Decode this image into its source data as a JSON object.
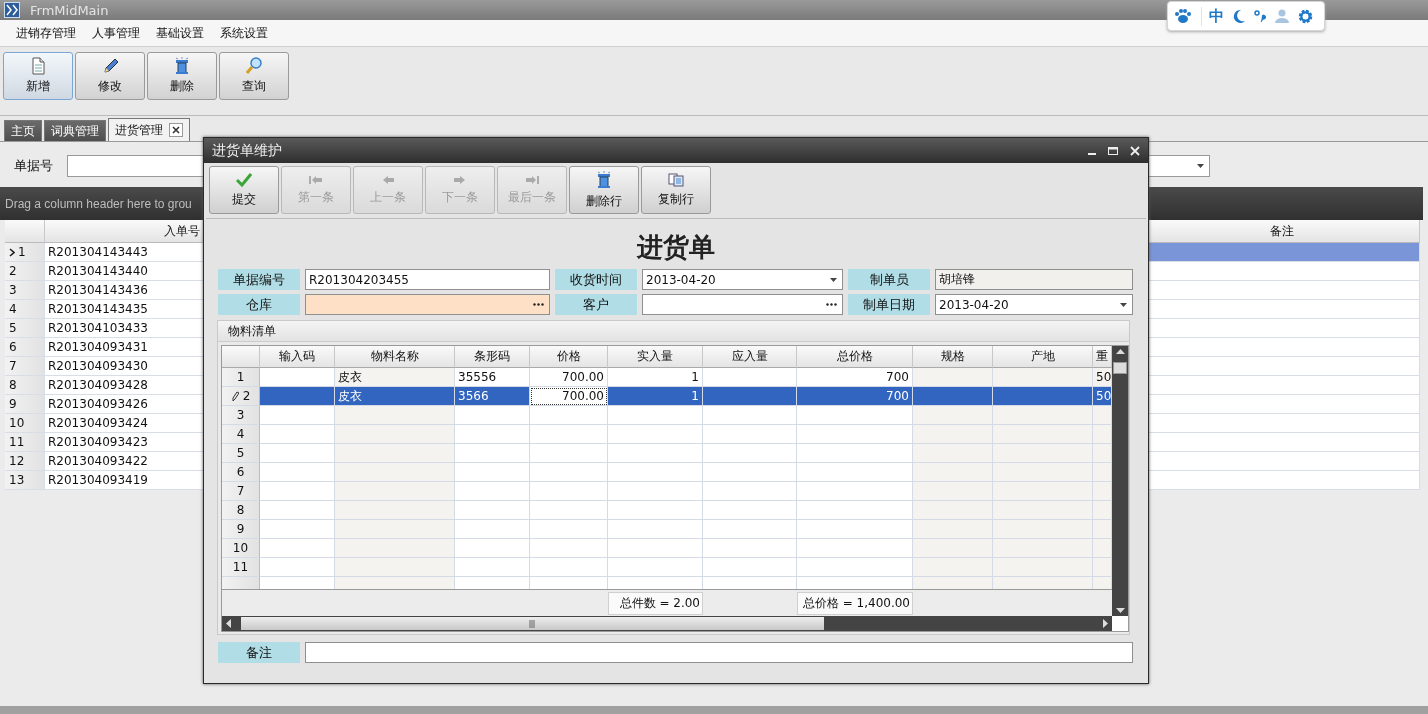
{
  "window": {
    "title": "FrmMidMain"
  },
  "menu": [
    "进销存管理",
    "人事管理",
    "基础设置",
    "系统设置"
  ],
  "toolbar": [
    {
      "label": "新增",
      "selected": true
    },
    {
      "label": "修改",
      "selected": false
    },
    {
      "label": "删除",
      "selected": false
    },
    {
      "label": "查询",
      "selected": false
    }
  ],
  "tabs": [
    {
      "label": "主页",
      "selected": false,
      "closable": false
    },
    {
      "label": "词典管理",
      "selected": false,
      "closable": false
    },
    {
      "label": "进货管理",
      "selected": true,
      "closable": true
    }
  ],
  "filter": {
    "label": "单据号"
  },
  "group_panel": {
    "hint": "Drag a column header here to grou"
  },
  "list": {
    "columns": [
      "入单号",
      "备注"
    ],
    "rows": [
      {
        "number": "1",
        "bill_no": "R201304143443",
        "selected": true
      },
      {
        "number": "2",
        "bill_no": "R201304143440",
        "selected": false
      },
      {
        "number": "3",
        "bill_no": "R201304143436",
        "selected": false
      },
      {
        "number": "4",
        "bill_no": "R201304143435",
        "selected": false
      },
      {
        "number": "5",
        "bill_no": "R201304103433",
        "selected": false
      },
      {
        "number": "6",
        "bill_no": "R201304093431",
        "selected": false
      },
      {
        "number": "7",
        "bill_no": "R201304093430",
        "selected": false
      },
      {
        "number": "8",
        "bill_no": "R201304093428",
        "selected": false
      },
      {
        "number": "9",
        "bill_no": "R201304093426",
        "selected": false
      },
      {
        "number": "10",
        "bill_no": "R201304093424",
        "selected": false
      },
      {
        "number": "11",
        "bill_no": "R201304093423",
        "selected": false
      },
      {
        "number": "12",
        "bill_no": "R201304093422",
        "selected": false
      },
      {
        "number": "13",
        "bill_no": "R201304093419",
        "selected": false
      }
    ]
  },
  "ime_bar": {
    "mode": "中"
  },
  "dialog": {
    "title": "进货单维护",
    "toolbar": [
      {
        "label": "提交",
        "disabled": false
      },
      {
        "label": "第一条",
        "disabled": true
      },
      {
        "label": "上一条",
        "disabled": true
      },
      {
        "label": "下一条",
        "disabled": true
      },
      {
        "label": "最后一条",
        "disabled": true
      },
      {
        "label": "删除行",
        "disabled": false
      },
      {
        "label": "复制行",
        "disabled": false
      }
    ],
    "heading": "进货单",
    "fields": [
      {
        "label": "单据编号",
        "value": "R201304203455",
        "kind": "text",
        "highlighted": false
      },
      {
        "label": "收货时间",
        "value": "2013-04-20",
        "kind": "date",
        "highlighted": false
      },
      {
        "label": "制单员",
        "value": "胡培锋",
        "kind": "readonly",
        "highlighted": false
      },
      {
        "label": "仓库",
        "kind": "lookup",
        "highlighted": true
      },
      {
        "label": "客户",
        "kind": "lookup",
        "highlighted": false
      },
      {
        "label": "制单日期",
        "value": "2013-04-20",
        "kind": "date",
        "highlighted": false
      }
    ],
    "materials": {
      "title": "物料清单",
      "columns": [
        {
          "label": "输入码",
          "readonly": false,
          "focused": false
        },
        {
          "label": "物料名称",
          "readonly": true,
          "focused": false
        },
        {
          "label": "条形码",
          "readonly": false,
          "focused": false
        },
        {
          "label": "价格",
          "readonly": false,
          "focused": true
        },
        {
          "label": "实入量",
          "readonly": false,
          "focused": false,
          "summary": "总件数 = 2.00"
        },
        {
          "label": "应入量",
          "readonly": false,
          "focused": false
        },
        {
          "label": "总价格",
          "readonly": false,
          "focused": false,
          "summary": "总价格 = 1,400.00"
        },
        {
          "label": "规格",
          "readonly": true,
          "focused": false
        },
        {
          "label": "产地",
          "readonly": true,
          "focused": false
        },
        {
          "label": "重",
          "readonly": true,
          "focused": false
        }
      ],
      "rows": [
        {
          "number": "1",
          "selected": false,
          "editing": false,
          "name": "皮衣",
          "barcode": "35556",
          "price": "700.00",
          "actual_qty": "1",
          "total": "700",
          "column_11": "50"
        },
        {
          "number": "2",
          "selected": true,
          "editing": true,
          "name": "皮衣",
          "barcode": "3566",
          "price": "700.00",
          "actual_qty": "1",
          "total": "700",
          "column_11": "50"
        },
        {
          "number": "3",
          "selected": false,
          "editing": false
        },
        {
          "number": "4",
          "selected": false,
          "editing": false
        },
        {
          "number": "5",
          "selected": false,
          "editing": false
        },
        {
          "number": "6",
          "selected": false,
          "editing": false
        },
        {
          "number": "7",
          "selected": false,
          "editing": false
        },
        {
          "number": "8",
          "selected": false,
          "editing": false
        },
        {
          "number": "9",
          "selected": false,
          "editing": false
        },
        {
          "number": "10",
          "selected": false,
          "editing": false
        },
        {
          "number": "11",
          "selected": false,
          "editing": false
        }
      ]
    },
    "remark": {
      "label": "备注"
    }
  }
}
